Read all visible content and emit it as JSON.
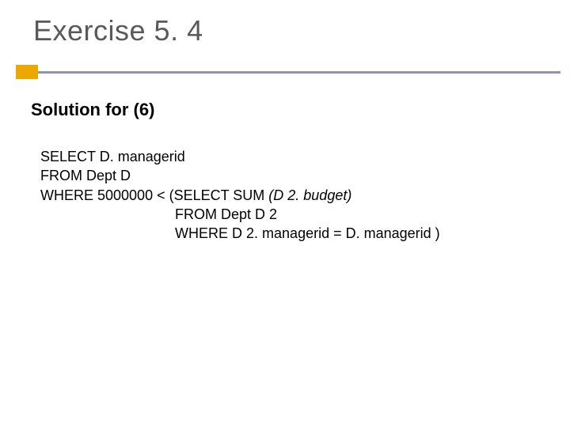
{
  "title": "Exercise 5. 4",
  "subtitle": "Solution for (6)",
  "sql": {
    "line1": "SELECT D. managerid",
    "line2": "FROM Dept D",
    "line3_a": "WHERE 5000000 < (SELECT SUM ",
    "line3_b": "(D 2. budget)",
    "line4": "                                  FROM Dept D 2",
    "line5": "                                  WHERE D 2. managerid = D. managerid )"
  }
}
